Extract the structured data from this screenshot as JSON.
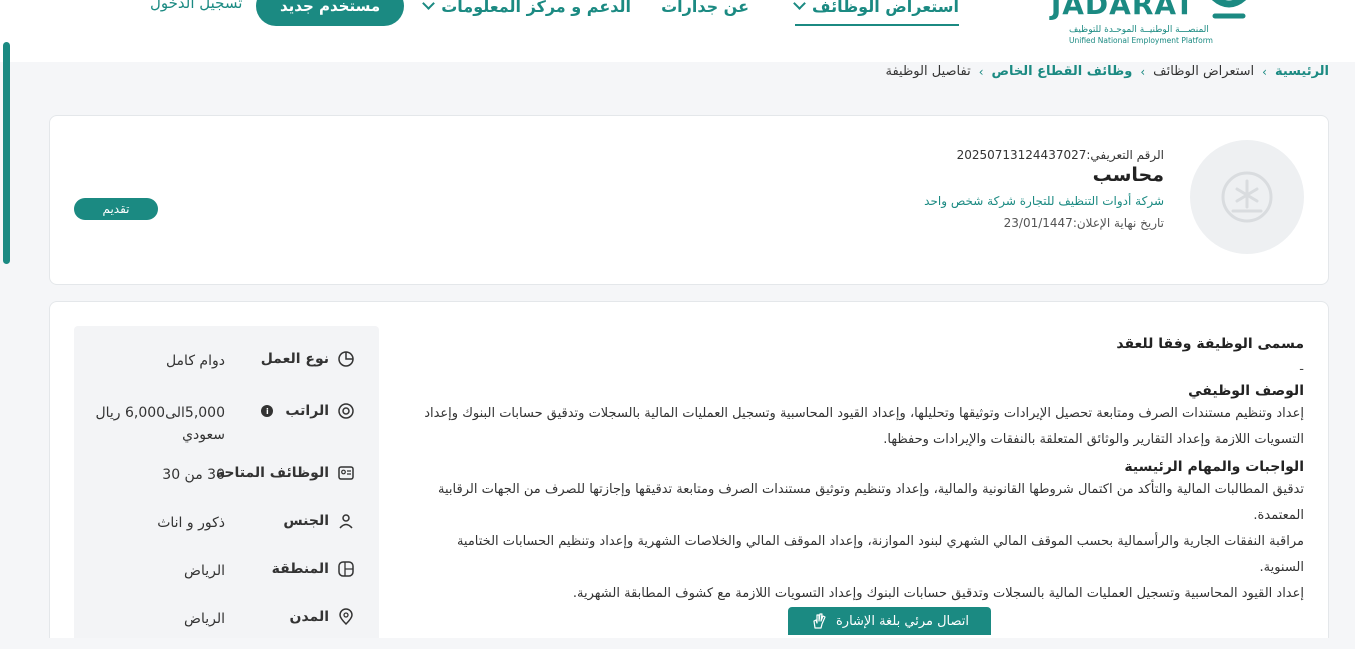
{
  "header": {
    "logo_word": "JADARAT",
    "logo_ar": "المنصـــة الوطنيــة الموحـدة للتوظيف",
    "logo_en": "Unified National Employment Platform",
    "nav": {
      "browse_jobs": "استعراض الوظائف",
      "about": "عن جدارات",
      "support": "الدعم و مركز المعلومات"
    },
    "register_label": "مستخدم جديد",
    "login_label": "تسجيل الدخول"
  },
  "breadcrumb": {
    "home": "الرئيسية",
    "browse_jobs": "استعراض الوظائف",
    "private_sector": "وظائف القطاع الخاص",
    "current": "تفاصيل الوظيفة"
  },
  "job": {
    "id_label": "الرقم التعريفي:",
    "id_value": "20250713124437027",
    "title": "محاسب",
    "company": "شركة أدوات التنظيف للتجارة شركة شخص واحد",
    "deadline_label": "تاريخ نهاية الإعلان:",
    "deadline_value": "23/01/1447",
    "apply_label": "تقديم"
  },
  "details": {
    "contract_title_heading": "مسمى الوظيفة وفقا للعقد",
    "contract_title_value": "-",
    "description_heading": "الوصف الوظيفي",
    "description_text": "إعداد وتنظيم مستندات الصرف ومتابعة تحصيل الإيرادات وتوثيقها وتحليلها، وإعداد القيود المحاسبية وتسجيل العمليات المالية بالسجلات وتدقيق حسابات البنوك وإعداد التسويات اللازمة وإعداد التقارير والوثائق المتعلقة بالنفقات والإيرادات وحفظها.",
    "duties_heading": "الواجبات والمهام الرئيسية",
    "duties": [
      "تدقيق المطالبات المالية والتأكد من اكتمال شروطها القانونية والمالية، وإعداد وتنظيم وتوثيق مستندات الصرف ومتابعة تدقيقها وإجازتها للصرف من الجهات الرقابية المعتمدة.",
      "مراقبة النفقات الجارية والرأسمالية بحسب الموقف المالي الشهري لبنود الموازنة، وإعداد الموقف المالي والخلاصات الشهرية وإعداد وتنظيم الحسابات الختامية السنوية.",
      "إعداد القيود المحاسبية وتسجيل العمليات المالية بالسجلات وتدقيق حسابات البنوك وإعداد التسويات اللازمة مع كشوف المطابقة الشهرية."
    ]
  },
  "attributes": {
    "work_type": {
      "label": "نوع العمل",
      "value": "دوام كامل",
      "icon": "pie-chart-icon"
    },
    "salary": {
      "label": "الراتب",
      "value": "5,000الى6,000 ريال سعودي",
      "icon": "money-icon"
    },
    "openings": {
      "label": "الوظائف المتاحة",
      "value": "30 من 30",
      "icon": "id-card-icon"
    },
    "gender": {
      "label": "الجنس",
      "value": "ذكور و اناث",
      "icon": "person-icon"
    },
    "region": {
      "label": "المنطقة",
      "value": "الرياض",
      "icon": "map-icon"
    },
    "city": {
      "label": "المدن",
      "value": "الرياض",
      "icon": "location-pin-icon"
    }
  },
  "sign_language_label": "اتصال مرئي بلغة الإشارة",
  "colors": {
    "accent": "#1b8a82",
    "background": "#f5f6f8"
  }
}
